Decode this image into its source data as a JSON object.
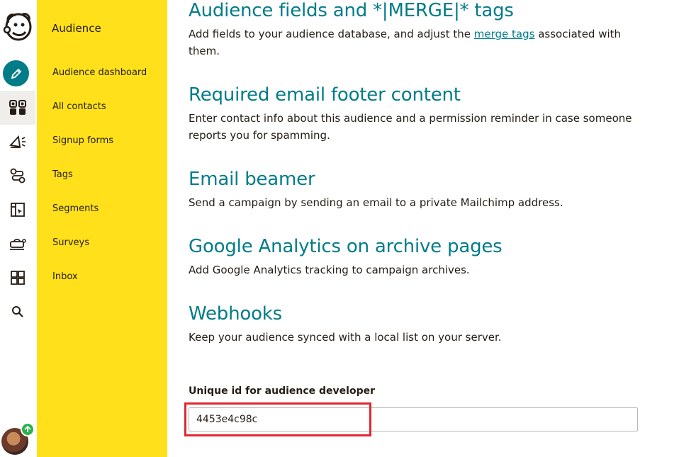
{
  "subnav": {
    "title": "Audience",
    "items": [
      {
        "label": "Audience dashboard"
      },
      {
        "label": "All contacts"
      },
      {
        "label": "Signup forms"
      },
      {
        "label": "Tags"
      },
      {
        "label": "Segments"
      },
      {
        "label": "Surveys"
      },
      {
        "label": "Inbox"
      }
    ]
  },
  "rail": {
    "icons": [
      "mailchimp-logo",
      "pencil-icon",
      "audience-icon",
      "campaigns-icon",
      "automations-icon",
      "website-icon",
      "content-icon",
      "integrations-icon",
      "search-icon"
    ]
  },
  "sections": [
    {
      "title": "Audience fields and *|MERGE|* tags",
      "desc_before": "Add fields to your audience database, and adjust the ",
      "link": "merge tags",
      "desc_after": " associated with them."
    },
    {
      "title": "Required email footer content",
      "desc": "Enter contact info about this audience and a permission reminder in case someone reports you for spamming."
    },
    {
      "title": "Email beamer",
      "desc": "Send a campaign by sending an email to a private Mailchimp address."
    },
    {
      "title": "Google Analytics on archive pages",
      "desc": "Add Google Analytics tracking to campaign archives."
    },
    {
      "title": "Webhooks",
      "desc": "Keep your audience synced with a local list on your server."
    }
  ],
  "unique_id": {
    "label": "Unique id for audience developer",
    "value": "4453e4c98c"
  },
  "colors": {
    "accent": "#007c89",
    "subnav_bg": "#ffe01b",
    "highlight": "#e2262f",
    "badge": "#2bb24c"
  }
}
